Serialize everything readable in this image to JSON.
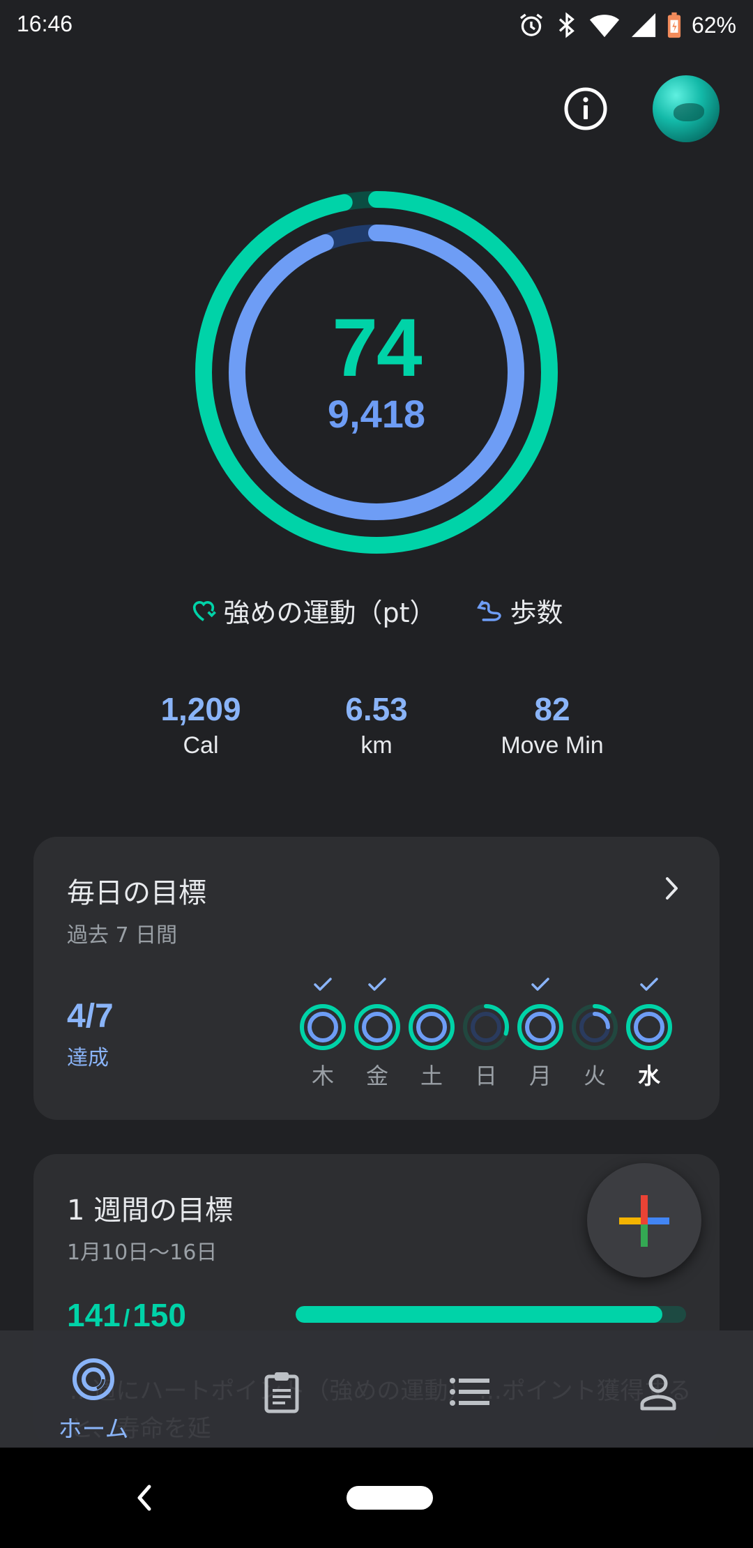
{
  "status_bar": {
    "time": "16:46",
    "battery_percent": "62%",
    "icons": [
      "alarm-icon",
      "bluetooth-icon",
      "wifi-icon",
      "signal-icon",
      "battery-icon"
    ]
  },
  "header": {
    "icons": [
      "info-icon",
      "avatar"
    ]
  },
  "summary": {
    "heart_points": "74",
    "steps": "9,418",
    "heart_points_progress": 0.97,
    "steps_progress": 0.94,
    "legend": {
      "heart_points_label": "強めの運動（pt）",
      "steps_label": "歩数"
    },
    "stats": [
      {
        "value": "1,209",
        "label": "Cal"
      },
      {
        "value": "6.53",
        "label": "km"
      },
      {
        "value": "82",
        "label": "Move Min"
      }
    ]
  },
  "daily_goals": {
    "title": "毎日の目標",
    "subtitle": "過去 7 日間",
    "achieved": "4/7",
    "achieved_label": "達成",
    "days": [
      {
        "label": "木",
        "achieved": true,
        "outer": 1.0,
        "inner": 1.0,
        "today": false
      },
      {
        "label": "金",
        "achieved": true,
        "outer": 1.0,
        "inner": 1.0,
        "today": false
      },
      {
        "label": "土",
        "achieved": false,
        "outer": 1.0,
        "inner": 1.0,
        "today": false
      },
      {
        "label": "日",
        "achieved": false,
        "outer": 0.3,
        "inner": 0.0,
        "today": false
      },
      {
        "label": "月",
        "achieved": true,
        "outer": 1.0,
        "inner": 1.0,
        "today": false
      },
      {
        "label": "火",
        "achieved": false,
        "outer": 0.12,
        "inner": 0.25,
        "today": false
      },
      {
        "label": "水",
        "achieved": true,
        "outer": 1.0,
        "inner": 1.0,
        "today": true
      }
    ]
  },
  "weekly_goal": {
    "title": "1 週間の目標",
    "date_range": "1月10日〜16日",
    "current": "141",
    "separator": "/",
    "target": "150",
    "progress": 0.94
  },
  "fab": {
    "icon": "plus-icon"
  },
  "bottom_nav": {
    "items": [
      {
        "label": "ホーム",
        "icon": "home-icon",
        "active": true
      },
      {
        "label": "",
        "icon": "journal-icon",
        "active": false
      },
      {
        "label": "",
        "icon": "browse-icon",
        "active": false
      },
      {
        "label": "",
        "icon": "profile-icon",
        "active": false
      }
    ],
    "ghost_text": "...週にハートポイント（強めの運動）\n...ポイント獲得すると、寿命を延"
  },
  "colors": {
    "background": "#202124",
    "card": "#2d2e31",
    "heart_green": "#00d3a8",
    "steps_blue": "#6e9df5",
    "accent_blue": "#8ab4f8"
  }
}
